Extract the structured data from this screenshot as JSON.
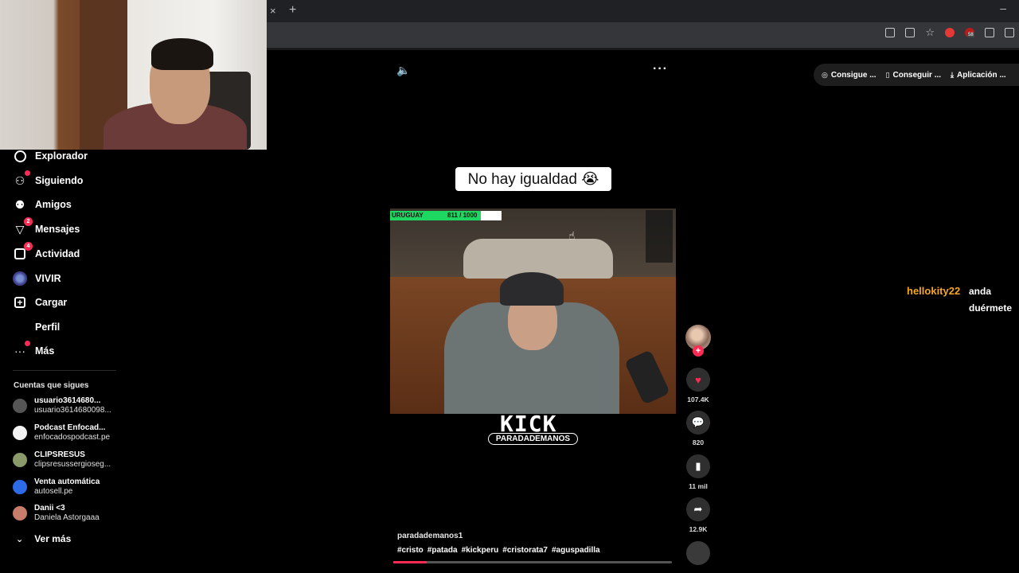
{
  "browser": {
    "tab_close": "×",
    "tab_new": "+",
    "window_minimize": "–",
    "ext_badge": "58"
  },
  "sidebar": {
    "items": [
      {
        "label": "Explorador",
        "icon": "compass-icon"
      },
      {
        "label": "Siguiendo",
        "icon": "following-icon"
      },
      {
        "label": "Amigos",
        "icon": "friends-icon"
      },
      {
        "label": "Mensajes",
        "icon": "messages-icon",
        "badge": "2"
      },
      {
        "label": "Actividad",
        "icon": "activity-icon",
        "badge": "4"
      },
      {
        "label": "VIVIR",
        "icon": "live-icon"
      },
      {
        "label": "Cargar",
        "icon": "upload-icon"
      },
      {
        "label": "Perfil",
        "icon": "profile-icon"
      },
      {
        "label": "Más",
        "icon": "more-icon"
      }
    ],
    "following_title": "Cuentas que sigues",
    "accounts": [
      {
        "name": "usuario3614680...",
        "handle": "usuario3614680098...",
        "color": "#555555"
      },
      {
        "name": "Podcast Enfocad...",
        "handle": "enfocadospodcast.pe",
        "color": "#f2f2f2"
      },
      {
        "name": "CLIPSRESUS",
        "handle": "clipsresussergioseg...",
        "color": "#8a9a6a"
      },
      {
        "name": "Venta automática",
        "handle": "autosell.pe",
        "color": "#2e6be6"
      },
      {
        "name": "Danii <3",
        "handle": "Daniela Astorgaaa",
        "color": "#c77d6a"
      }
    ],
    "see_more": "Ver más"
  },
  "video": {
    "caption": "No hay igualdad 😭",
    "overlay_bar_label": "URUGUAY",
    "overlay_bar_count": "811 / 1000",
    "overlay_bar_progress": 0.811,
    "kick_logo": "KICK",
    "kick_handle": "PARADADEMANOS",
    "username": "paradademanos1",
    "tags": [
      "#cristo",
      "#patada",
      "#kickperu",
      "#cristorata7",
      "#aguspadilla"
    ],
    "progress": 0.12
  },
  "actions": {
    "likes": "107.4K",
    "comments": "820",
    "saves": "11 mil",
    "shares": "12.9K"
  },
  "header": {
    "pill1": "Consigue ...",
    "pill2": "Conseguir ...",
    "pill3": "Aplicación ..."
  },
  "stream_chat": {
    "user": "hellokity22",
    "message_line1": "anda",
    "message_line2": "duérmete"
  },
  "colors": {
    "accent": "#fe2c55",
    "chat_user": "#f5a623"
  }
}
